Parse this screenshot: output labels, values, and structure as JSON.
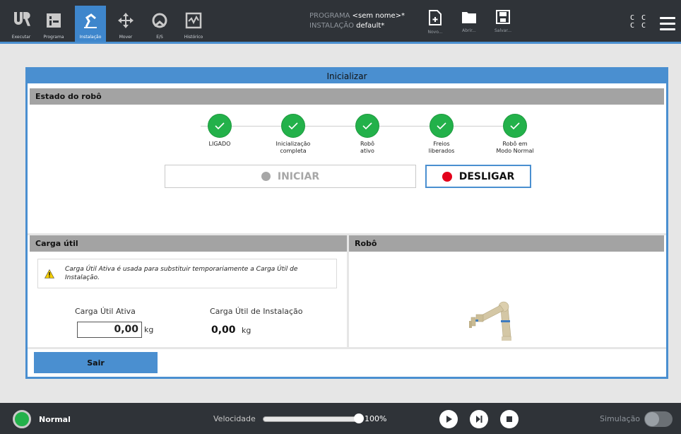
{
  "header": {
    "tabs": [
      {
        "label": "Executar",
        "icon": "ur-logo-icon"
      },
      {
        "label": "Programa",
        "icon": "program-icon"
      },
      {
        "label": "Instalação",
        "icon": "installation-icon",
        "active": true
      },
      {
        "label": "Mover",
        "icon": "move-icon"
      },
      {
        "label": "E/S",
        "icon": "io-icon"
      },
      {
        "label": "Histórico",
        "icon": "history-icon"
      }
    ],
    "program_label": "PROGRAMA",
    "program_value": "<sem nome>*",
    "installation_label": "INSTALAÇÃO",
    "installation_value": "default*",
    "file_buttons": [
      {
        "label": "Novo...",
        "icon": "new-file-icon"
      },
      {
        "label": "Abrir...",
        "icon": "open-folder-icon"
      },
      {
        "label": "Salvar...",
        "icon": "save-icon"
      }
    ],
    "cc_line1": "C C",
    "cc_line2": "C C"
  },
  "dialog": {
    "title": "Inicializar",
    "robot_state": {
      "heading": "Estado do robô",
      "steps": [
        {
          "line1": "LIGADO",
          "line2": ""
        },
        {
          "line1": "Inicialização",
          "line2": "completa"
        },
        {
          "line1": "Robô",
          "line2": "ativo"
        },
        {
          "line1": "Freios",
          "line2": "liberados"
        },
        {
          "line1": "Robô em",
          "line2": "Modo Normal"
        }
      ],
      "start_button": "INICIAR",
      "shutdown_button": "DESLIGAR"
    },
    "payload": {
      "heading": "Carga útil",
      "warning": "Carga Útil Ativa é usada para substituir temporariamente a Carga Útil de Instalação.",
      "active_label": "Carga Útil Ativa",
      "active_value": "0,00",
      "active_unit": "kg",
      "installation_label": "Carga Útil de Instalação",
      "installation_value": "0,00",
      "installation_unit": "kg"
    },
    "robot_panel": {
      "heading": "Robô"
    },
    "exit_button": "Sair"
  },
  "footer": {
    "status": "Normal",
    "status_color": "#23b14a",
    "speed_label": "Velocidade",
    "speed_value": "100%",
    "speed_fraction": 1.0,
    "simulation_label": "Simulação"
  },
  "colors": {
    "accent": "#4a8fd0",
    "success": "#23b14a",
    "danger": "#e3001b",
    "topbar": "#2f3338"
  }
}
